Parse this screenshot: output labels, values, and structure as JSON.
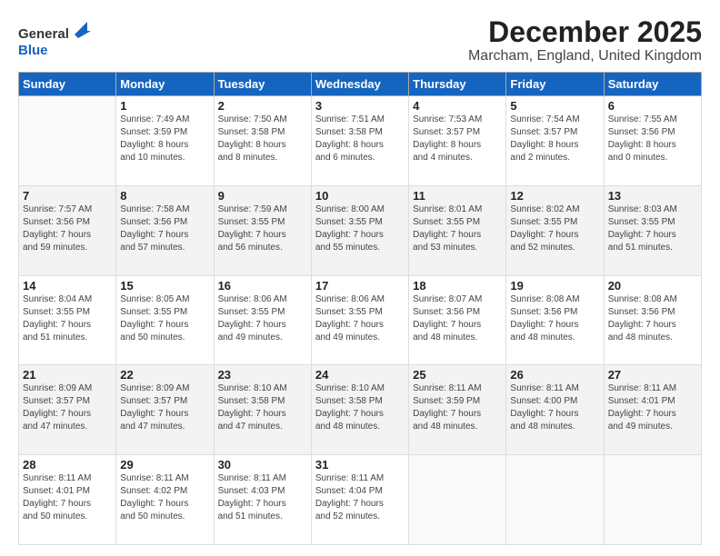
{
  "header": {
    "logo": {
      "line1": "General",
      "line2": "Blue"
    },
    "title": "December 2025",
    "subtitle": "Marcham, England, United Kingdom"
  },
  "columns": [
    "Sunday",
    "Monday",
    "Tuesday",
    "Wednesday",
    "Thursday",
    "Friday",
    "Saturday"
  ],
  "rows": [
    [
      {
        "day": "",
        "text": ""
      },
      {
        "day": "1",
        "text": "Sunrise: 7:49 AM\nSunset: 3:59 PM\nDaylight: 8 hours\nand 10 minutes."
      },
      {
        "day": "2",
        "text": "Sunrise: 7:50 AM\nSunset: 3:58 PM\nDaylight: 8 hours\nand 8 minutes."
      },
      {
        "day": "3",
        "text": "Sunrise: 7:51 AM\nSunset: 3:58 PM\nDaylight: 8 hours\nand 6 minutes."
      },
      {
        "day": "4",
        "text": "Sunrise: 7:53 AM\nSunset: 3:57 PM\nDaylight: 8 hours\nand 4 minutes."
      },
      {
        "day": "5",
        "text": "Sunrise: 7:54 AM\nSunset: 3:57 PM\nDaylight: 8 hours\nand 2 minutes."
      },
      {
        "day": "6",
        "text": "Sunrise: 7:55 AM\nSunset: 3:56 PM\nDaylight: 8 hours\nand 0 minutes."
      }
    ],
    [
      {
        "day": "7",
        "text": "Sunrise: 7:57 AM\nSunset: 3:56 PM\nDaylight: 7 hours\nand 59 minutes."
      },
      {
        "day": "8",
        "text": "Sunrise: 7:58 AM\nSunset: 3:56 PM\nDaylight: 7 hours\nand 57 minutes."
      },
      {
        "day": "9",
        "text": "Sunrise: 7:59 AM\nSunset: 3:55 PM\nDaylight: 7 hours\nand 56 minutes."
      },
      {
        "day": "10",
        "text": "Sunrise: 8:00 AM\nSunset: 3:55 PM\nDaylight: 7 hours\nand 55 minutes."
      },
      {
        "day": "11",
        "text": "Sunrise: 8:01 AM\nSunset: 3:55 PM\nDaylight: 7 hours\nand 53 minutes."
      },
      {
        "day": "12",
        "text": "Sunrise: 8:02 AM\nSunset: 3:55 PM\nDaylight: 7 hours\nand 52 minutes."
      },
      {
        "day": "13",
        "text": "Sunrise: 8:03 AM\nSunset: 3:55 PM\nDaylight: 7 hours\nand 51 minutes."
      }
    ],
    [
      {
        "day": "14",
        "text": "Sunrise: 8:04 AM\nSunset: 3:55 PM\nDaylight: 7 hours\nand 51 minutes."
      },
      {
        "day": "15",
        "text": "Sunrise: 8:05 AM\nSunset: 3:55 PM\nDaylight: 7 hours\nand 50 minutes."
      },
      {
        "day": "16",
        "text": "Sunrise: 8:06 AM\nSunset: 3:55 PM\nDaylight: 7 hours\nand 49 minutes."
      },
      {
        "day": "17",
        "text": "Sunrise: 8:06 AM\nSunset: 3:55 PM\nDaylight: 7 hours\nand 49 minutes."
      },
      {
        "day": "18",
        "text": "Sunrise: 8:07 AM\nSunset: 3:56 PM\nDaylight: 7 hours\nand 48 minutes."
      },
      {
        "day": "19",
        "text": "Sunrise: 8:08 AM\nSunset: 3:56 PM\nDaylight: 7 hours\nand 48 minutes."
      },
      {
        "day": "20",
        "text": "Sunrise: 8:08 AM\nSunset: 3:56 PM\nDaylight: 7 hours\nand 48 minutes."
      }
    ],
    [
      {
        "day": "21",
        "text": "Sunrise: 8:09 AM\nSunset: 3:57 PM\nDaylight: 7 hours\nand 47 minutes."
      },
      {
        "day": "22",
        "text": "Sunrise: 8:09 AM\nSunset: 3:57 PM\nDaylight: 7 hours\nand 47 minutes."
      },
      {
        "day": "23",
        "text": "Sunrise: 8:10 AM\nSunset: 3:58 PM\nDaylight: 7 hours\nand 47 minutes."
      },
      {
        "day": "24",
        "text": "Sunrise: 8:10 AM\nSunset: 3:58 PM\nDaylight: 7 hours\nand 48 minutes."
      },
      {
        "day": "25",
        "text": "Sunrise: 8:11 AM\nSunset: 3:59 PM\nDaylight: 7 hours\nand 48 minutes."
      },
      {
        "day": "26",
        "text": "Sunrise: 8:11 AM\nSunset: 4:00 PM\nDaylight: 7 hours\nand 48 minutes."
      },
      {
        "day": "27",
        "text": "Sunrise: 8:11 AM\nSunset: 4:01 PM\nDaylight: 7 hours\nand 49 minutes."
      }
    ],
    [
      {
        "day": "28",
        "text": "Sunrise: 8:11 AM\nSunset: 4:01 PM\nDaylight: 7 hours\nand 50 minutes."
      },
      {
        "day": "29",
        "text": "Sunrise: 8:11 AM\nSunset: 4:02 PM\nDaylight: 7 hours\nand 50 minutes."
      },
      {
        "day": "30",
        "text": "Sunrise: 8:11 AM\nSunset: 4:03 PM\nDaylight: 7 hours\nand 51 minutes."
      },
      {
        "day": "31",
        "text": "Sunrise: 8:11 AM\nSunset: 4:04 PM\nDaylight: 7 hours\nand 52 minutes."
      },
      {
        "day": "",
        "text": ""
      },
      {
        "day": "",
        "text": ""
      },
      {
        "day": "",
        "text": ""
      }
    ]
  ]
}
